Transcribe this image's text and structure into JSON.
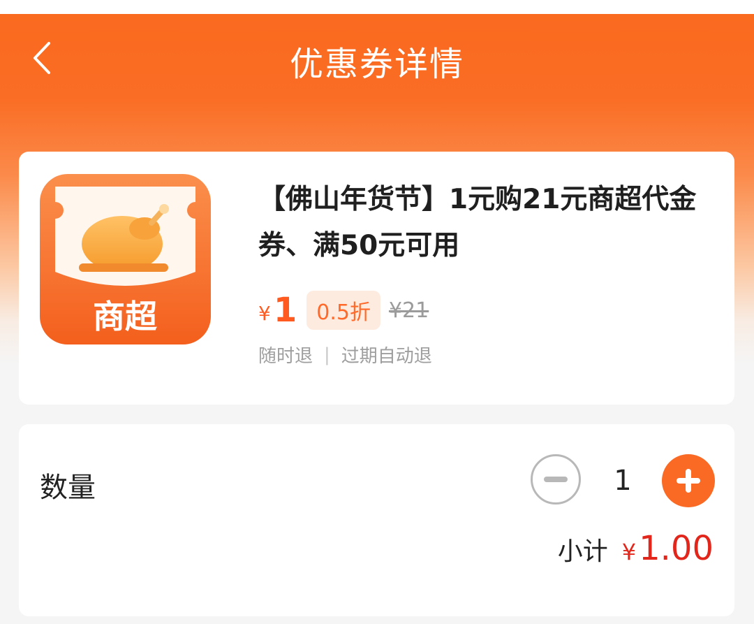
{
  "header": {
    "title": "优惠券详情",
    "back_icon": "chevron-left-icon",
    "color": "#fa6a1f"
  },
  "coupon": {
    "thumbnail": {
      "label": "商超",
      "icon": "roast-chicken-icon",
      "color": "#f86d25"
    },
    "title": "【佛山年货节】1元购21元商超代金券、满50元可用",
    "price_symbol": "¥",
    "price": "1",
    "discount": "0.5折",
    "original_price": "¥21",
    "refund_any_time": "随时退",
    "refund_separator": "|",
    "refund_on_expiry": "过期自动退"
  },
  "quantity": {
    "label": "数量",
    "value": "1",
    "minus_icon": "minus-icon",
    "plus_icon": "plus-icon"
  },
  "subtotal": {
    "label": "小计",
    "symbol": "¥",
    "value": "1.00",
    "color": "#e2261b"
  }
}
